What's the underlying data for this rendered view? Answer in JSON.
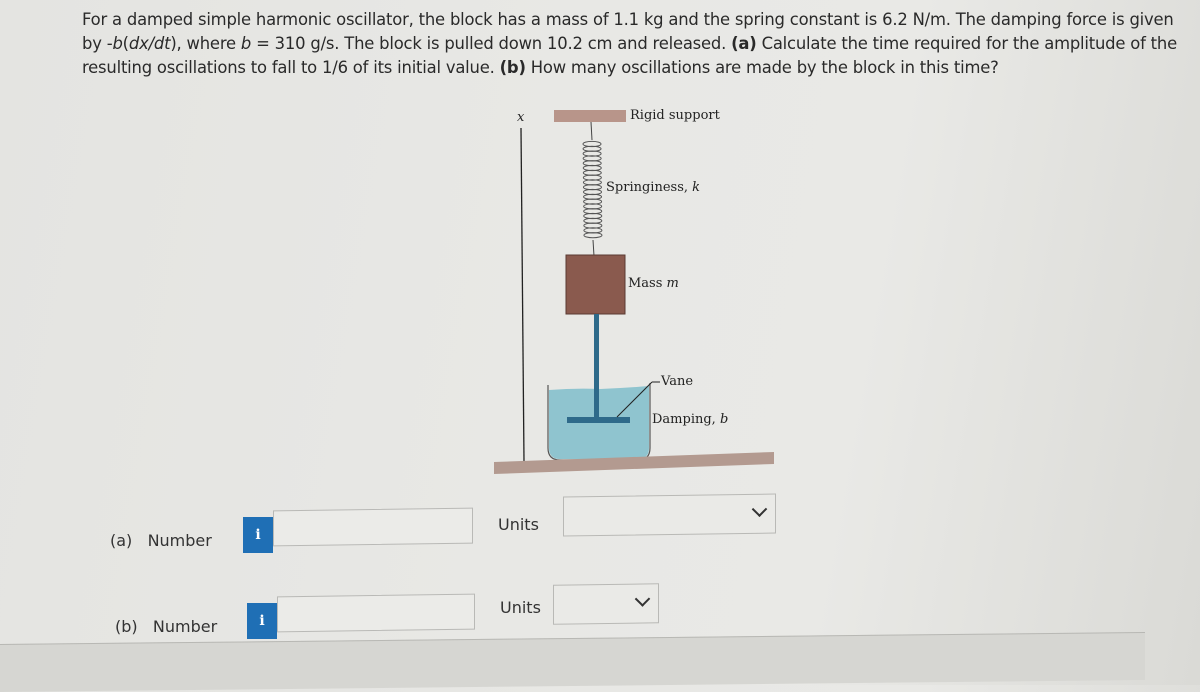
{
  "problem": {
    "lines": [
      "For a damped simple harmonic oscillator, the block has a mass of 1.1 kg and the spring constant is 6.2 N/m. The damping force is given",
      "by -b(dx/dt), where b = 310 g/s. The block is pulled down 10.2 cm and released. (a) Calculate the time required for the amplitude of the",
      "resulting oscillations to fall to 1/6 of its initial value. (b) How many oscillations are made by the block in this time?"
    ],
    "segments": {
      "l2_prefix": "by -",
      "l2_b": "b",
      "l2_paren_open": "(",
      "l2_dxdt": "dx/dt",
      "l2_paren_close": "), where ",
      "l2_b2": "b",
      "l2_rest": " = 310 g/s. The block is pulled down 10.2 cm and released. ",
      "l2_a": "(a)",
      "l2_tail": " Calculate the time required for the amplitude of the",
      "l3_head": "resulting oscillations to fall to 1/6 of its initial value. ",
      "l3_b": "(b)",
      "l3_tail": " How many oscillations are made by the block in this time?"
    }
  },
  "figure": {
    "axis_label": "x",
    "rigid_support": "Rigid support",
    "springiness": "Springiness, ",
    "springiness_sym": "k",
    "mass": "Mass ",
    "mass_sym": "m",
    "vane": "Vane",
    "damping": "Damping, ",
    "damping_sym": "b",
    "colors": {
      "support": "#b8958a",
      "mass": "#8a5a4e",
      "water": "#8fc4cf",
      "rod": "#2e6a8a",
      "floor": "#b39a90"
    }
  },
  "answers": {
    "a": {
      "label": "(a)",
      "field_label": "Number",
      "value": "",
      "units_label": "Units",
      "units_value": ""
    },
    "b": {
      "label": "(b)",
      "field_label": "Number",
      "value": "",
      "units_label": "Units",
      "units_value": ""
    },
    "info_icon": "i"
  }
}
